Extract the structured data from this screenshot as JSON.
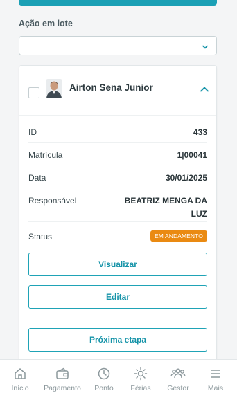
{
  "batch_action": {
    "label": "Ação em lote",
    "selected": ""
  },
  "employee": {
    "name": "Airton Sena Junior"
  },
  "details": [
    {
      "label": "ID",
      "value": "433"
    },
    {
      "label": "Matrícula",
      "value": "1|00041"
    },
    {
      "label": "Data",
      "value": "30/01/2025"
    },
    {
      "label": "Responsável",
      "value": "BEATRIZ MENGA DA LUZ"
    }
  ],
  "status": {
    "label": "Status",
    "badge": "EM ANDAMENTO",
    "badge_color": "#ea8a12"
  },
  "actions": {
    "view": "Visualizar",
    "edit": "Editar",
    "next": "Próxima etapa"
  },
  "nav": [
    {
      "label": "Início",
      "icon": "home-icon"
    },
    {
      "label": "Pagamento",
      "icon": "wallet-icon"
    },
    {
      "label": "Ponto",
      "icon": "clock-icon"
    },
    {
      "label": "Férias",
      "icon": "sun-icon"
    },
    {
      "label": "Gestor",
      "icon": "team-icon"
    },
    {
      "label": "Mais",
      "icon": "menu-icon"
    }
  ],
  "colors": {
    "accent": "#1ba0b5",
    "text": "#2e3a3f",
    "nav_icon": "#8c989c"
  }
}
